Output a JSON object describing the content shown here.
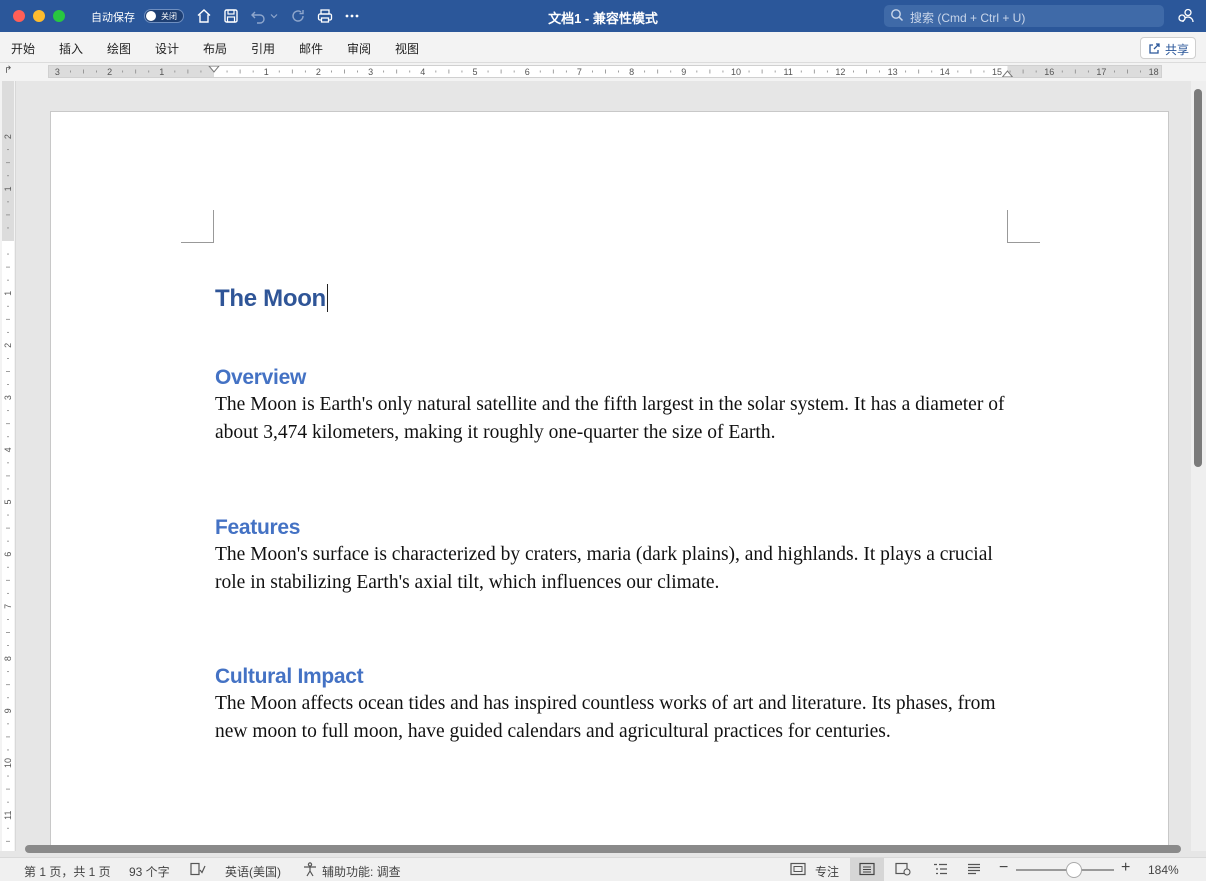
{
  "app": {
    "title": "文档1 - 兼容性模式",
    "autosave_label": "自动保存",
    "autosave_state": "关闭",
    "search_placeholder": "搜索 (Cmd + Ctrl + U)"
  },
  "toolbar_icons": [
    "home-icon",
    "save-icon",
    "undo-icon",
    "redo-icon",
    "print-icon",
    "more-icon"
  ],
  "ribbon": {
    "tabs": [
      "开始",
      "插入",
      "绘图",
      "设计",
      "布局",
      "引用",
      "邮件",
      "审阅",
      "视图"
    ],
    "share_label": "共享"
  },
  "ruler": {
    "horizontal_ticks": [
      "3",
      "2",
      "1",
      "1",
      "2",
      "3",
      "4",
      "5",
      "6",
      "7",
      "8",
      "9",
      "10",
      "11",
      "12",
      "13",
      "14",
      "15",
      "16",
      "17",
      "18"
    ],
    "vertical_ticks": [
      "2",
      "1",
      "1",
      "2",
      "3",
      "4",
      "5",
      "6",
      "7",
      "8",
      "9",
      "10",
      "11"
    ]
  },
  "document": {
    "title": "The Moon",
    "sections": [
      {
        "heading": "Overview",
        "body": "The Moon is Earth's only natural satellite and the fifth largest in the solar system. It has a diameter of about 3,474 kilometers, making it roughly one-quarter the size of Earth."
      },
      {
        "heading": "Features",
        "body": "The Moon's surface is characterized by craters, maria (dark plains), and highlands. It plays a crucial role in stabilizing Earth's axial tilt, which influences our climate."
      },
      {
        "heading": "Cultural Impact",
        "body": "The Moon affects ocean tides and has inspired countless works of art and literature. Its phases, from new moon to full moon, have guided calendars and agricultural practices for centuries."
      }
    ]
  },
  "status": {
    "page": "第 1 页，共 1 页",
    "words": "93 个字",
    "language": "英语(美国)",
    "accessibility": "辅助功能: 调查",
    "focus": "专注",
    "zoom": "184%"
  },
  "colors": {
    "titlebar": "#2b579a",
    "doc_title": "#2f5597",
    "heading": "#4472c4"
  }
}
